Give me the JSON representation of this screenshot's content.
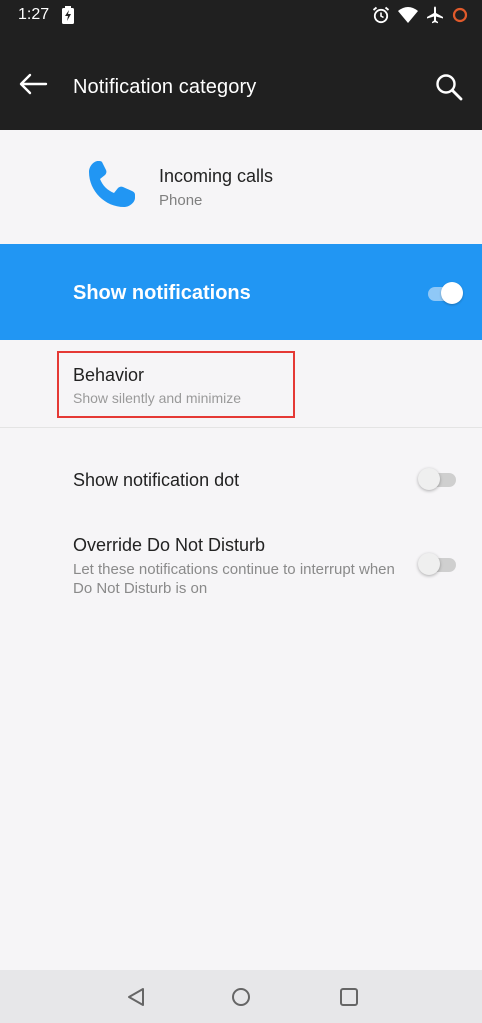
{
  "status_bar": {
    "time": "1:27"
  },
  "app_bar": {
    "title": "Notification category"
  },
  "app_header": {
    "name": "Incoming calls",
    "subtitle": "Phone"
  },
  "master_toggle": {
    "label": "Show notifications",
    "enabled": true
  },
  "behavior": {
    "title": "Behavior",
    "subtitle": "Show silently and minimize"
  },
  "settings": {
    "notification_dot": {
      "title": "Show notification dot",
      "enabled": false
    },
    "override_dnd": {
      "title": "Override Do Not Disturb",
      "description": "Let these notifications continue to interrupt when Do Not Disturb is on",
      "enabled": false
    }
  },
  "colors": {
    "app_bar_bg": "#202020",
    "accent": "#2196f3",
    "highlight_border": "#e53935",
    "app_icon": "#2196f3"
  },
  "icons": {
    "back": "arrow-left-icon",
    "search": "search-icon",
    "app": "phone-icon",
    "status": [
      "battery-charging-icon",
      "alarm-icon",
      "wifi-icon",
      "airplane-icon",
      "circle-icon"
    ],
    "nav": [
      "nav-back-icon",
      "nav-home-icon",
      "nav-recents-icon"
    ]
  }
}
